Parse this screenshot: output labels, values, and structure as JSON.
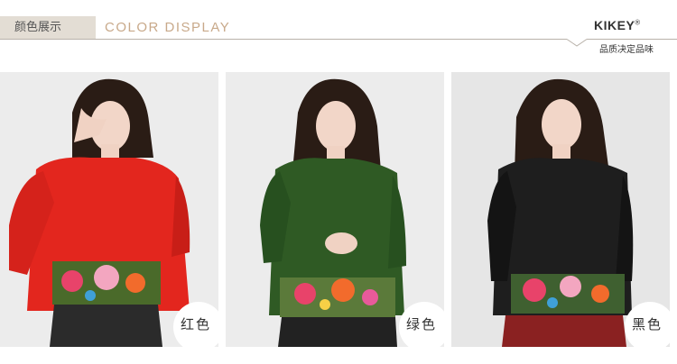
{
  "header": {
    "cn_title": "颜色展示",
    "en_title": "COLOR DISPLAY",
    "brand": "KIKEY",
    "brand_mark": "®",
    "brand_subtitle": "品质决定品味"
  },
  "colors": [
    {
      "label": "红色",
      "jacket": "#e3261e",
      "jacket_dark": "#b81a14",
      "bg": "#ececec",
      "skirt": "#2b2b2b"
    },
    {
      "label": "绿色",
      "jacket": "#2f5a24",
      "jacket_dark": "#1f3f18",
      "bg": "#ececec",
      "skirt": "#222222"
    },
    {
      "label": "黑色",
      "jacket": "#1e1e1e",
      "jacket_dark": "#0c0c0c",
      "bg": "#e6e6e6",
      "skirt": "#8a2121"
    }
  ]
}
